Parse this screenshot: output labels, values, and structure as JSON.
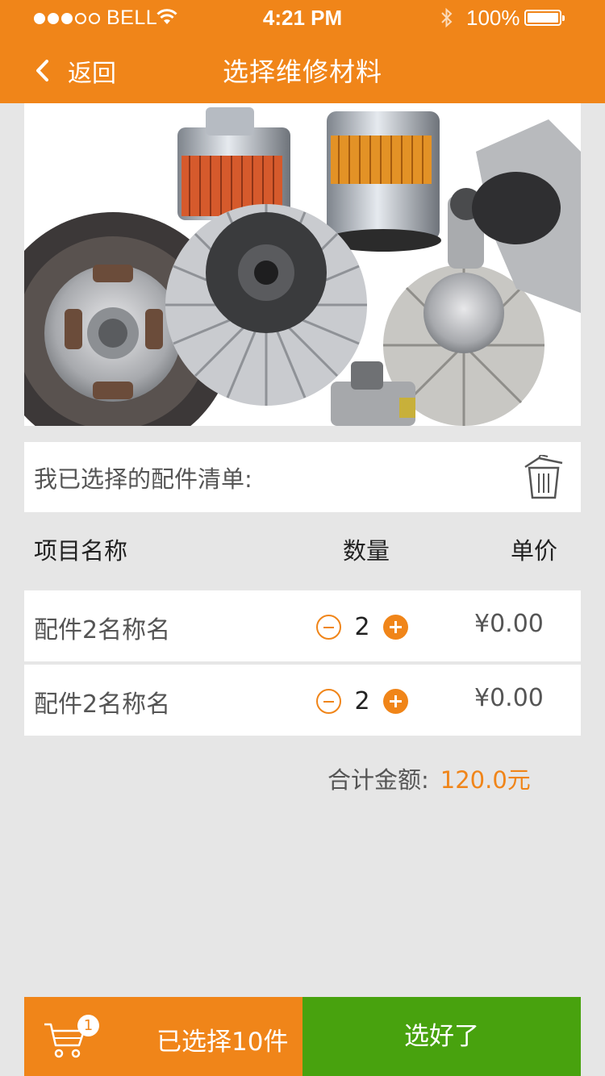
{
  "status_bar": {
    "carrier": "BELL",
    "time": "4:21 PM",
    "battery": "100%"
  },
  "nav": {
    "back_label": "返回",
    "title": "选择维修材料"
  },
  "banner": {
    "icon": "auto-parts-photo"
  },
  "selected_list": {
    "heading": "我已选择的配件清单:",
    "columns": {
      "name": "项目名称",
      "qty": "数量",
      "price": "单价"
    },
    "items": [
      {
        "name": "配件2名称名",
        "qty": "2",
        "price": "¥0.00"
      },
      {
        "name": "配件2名称名",
        "qty": "2",
        "price": "¥0.00"
      }
    ],
    "total_label": "合计金额:",
    "total_amount": "120.0元"
  },
  "bottom_bar": {
    "cart_badge": "1",
    "selected_text": "已选择10件",
    "confirm_label": "选好了"
  },
  "colors": {
    "accent": "#f08519",
    "confirm": "#48a20e",
    "background": "#e6e6e6"
  }
}
